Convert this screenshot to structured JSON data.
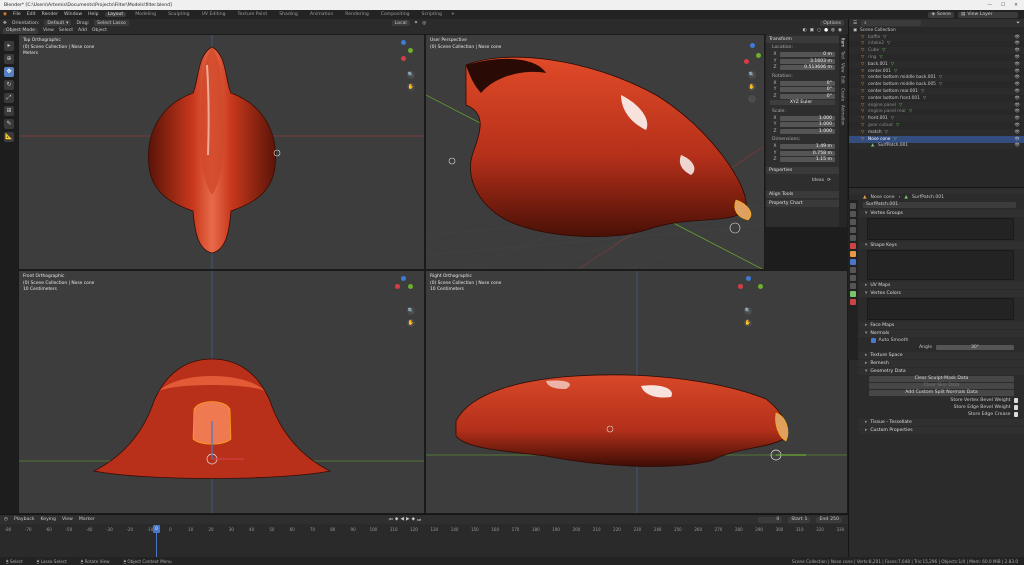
{
  "window": {
    "title": "Blender* [C:\\Users\\Artemis\\Documents\\Projects\\Filter\\Models\\filter.blend]"
  },
  "menus": [
    "File",
    "Edit",
    "Render",
    "Window",
    "Help"
  ],
  "workspaces": [
    "Layout",
    "Modeling",
    "Sculpting",
    "UV Editing",
    "Texture Paint",
    "Shading",
    "Animation",
    "Rendering",
    "Compositing",
    "Scripting"
  ],
  "active_workspace": "Layout",
  "header": {
    "scene_label": "Scene",
    "view_layer_label": "View Layer",
    "orientation_label": "Orientation:",
    "orientation_value": "Default",
    "drag_label": "Drag:",
    "drag_value": "Select Lasso",
    "pivot": "Local",
    "options": "Options"
  },
  "viewport_header": {
    "mode": "Object Mode",
    "view": "View",
    "select": "Select",
    "add": "Add",
    "object": "Object"
  },
  "viewports": [
    {
      "name": "Top Orthographic",
      "collection": "(0) Scene Collection | Nose cone",
      "units": "Meters"
    },
    {
      "name": "User Perspective",
      "collection": "(0) Scene Collection | Nose cone",
      "units": ""
    },
    {
      "name": "Front Orthographic",
      "collection": "(0) Scene Collection | Nose cone",
      "units": "10 Centimeters"
    },
    {
      "name": "Right Orthographic",
      "collection": "(0) Scene Collection | Nose cone",
      "units": "10 Centimeters"
    }
  ],
  "npanel": {
    "transform": "Transform",
    "location": "Location:",
    "loc": [
      {
        "k": "X",
        "v": "0 m"
      },
      {
        "k": "Y",
        "v": "3.1603 m"
      },
      {
        "k": "Z",
        "v": "0.513606 m"
      }
    ],
    "rotation": "Rotation:",
    "rot": [
      {
        "k": "X",
        "v": "0°"
      },
      {
        "k": "Y",
        "v": "0°"
      },
      {
        "k": "Z",
        "v": "0°"
      }
    ],
    "rot_mode": "XYZ Euler",
    "scale": "Scale:",
    "scl": [
      {
        "k": "X",
        "v": "1.000"
      },
      {
        "k": "Y",
        "v": "1.000"
      },
      {
        "k": "Z",
        "v": "1.000"
      }
    ],
    "dimensions": "Dimensions:",
    "dim": [
      {
        "k": "X",
        "v": "1.49 m"
      },
      {
        "k": "Y",
        "v": "0.758 m"
      },
      {
        "k": "Z",
        "v": "1.15 m"
      }
    ],
    "properties": "Properties",
    "ideas": "Ideas",
    "align_tools": "Align Tools",
    "property_chart": "Property Chart",
    "tabs": [
      "Item",
      "Tool",
      "View",
      "Edit",
      "Create",
      "Animation",
      "BlenderKit",
      "Archipack",
      "MACHIN3"
    ]
  },
  "outliner": {
    "root": "Scene Collection",
    "items": [
      {
        "name": "baffle",
        "extra": "",
        "dim": true
      },
      {
        "name": "intake2",
        "extra": "",
        "dim": true
      },
      {
        "name": "Cube",
        "extra": "",
        "dim": true
      },
      {
        "name": "ring",
        "extra": "",
        "dim": true
      },
      {
        "name": "back.001",
        "extra": "",
        "dim": false
      },
      {
        "name": "center.001",
        "extra": "",
        "dim": false
      },
      {
        "name": "center bottom middle back.001",
        "extra": "",
        "dim": false
      },
      {
        "name": "center bottom middle back.005",
        "extra": "",
        "dim": false
      },
      {
        "name": "center bottom rear.001",
        "extra": "",
        "dim": false
      },
      {
        "name": "center bottom front.001",
        "extra": "",
        "dim": false
      },
      {
        "name": "engine panel",
        "extra": "",
        "dim": true
      },
      {
        "name": "engine panel rear",
        "extra": "",
        "dim": true
      },
      {
        "name": "front.001",
        "extra": "",
        "dim": false
      },
      {
        "name": "gear cutout",
        "extra": "",
        "dim": true
      },
      {
        "name": "match",
        "extra": "",
        "dim": false
      },
      {
        "name": "Nose cone",
        "extra": "",
        "dim": false,
        "selected": true
      },
      {
        "name": "SurfPatch.001",
        "extra": "",
        "dim": false,
        "child": true
      }
    ]
  },
  "properties": {
    "object_name": "Nose cone",
    "data_name": "SurfPatch.001",
    "mesh_field": "SurfPatch.001",
    "sections": {
      "vertex_groups": "Vertex Groups",
      "shape_keys": "Shape Keys",
      "uv_maps": "UV Maps",
      "vertex_colors": "Vertex Colors",
      "face_maps": "Face Maps",
      "normals": "Normals",
      "auto_smooth": "Auto Smooth",
      "angle_label": "Angle",
      "angle_value": "30°",
      "texture_space": "Texture Space",
      "remesh": "Remesh",
      "geometry_data": "Geometry Data",
      "clear_sculpt": "Clear Sculpt-Mask Data",
      "clear_skin": "Clear Skin Data",
      "add_custom_split": "Add Custom Split Normals Data",
      "store_vertex_bevel": "Store Vertex Bevel Weight",
      "store_edge_bevel": "Store Edge Bevel Weight",
      "store_edge_crease": "Store Edge Crease",
      "tissue": "Tissue - Tessellate",
      "custom_props": "Custom Properties"
    }
  },
  "timeline": {
    "menus": [
      "Playback",
      "Keying",
      "View",
      "Marker"
    ],
    "current_frame": "0",
    "start_label": "Start",
    "start": "1",
    "end_label": "End",
    "end": "250",
    "ticks": [
      "-80",
      "-70",
      "-60",
      "-50",
      "-40",
      "-30",
      "-20",
      "-10",
      "0",
      "10",
      "20",
      "30",
      "40",
      "50",
      "60",
      "70",
      "80",
      "90",
      "100",
      "110",
      "120",
      "130",
      "140",
      "150",
      "160",
      "170",
      "180",
      "190",
      "200",
      "210",
      "220",
      "230",
      "240",
      "250",
      "260",
      "270",
      "280",
      "290",
      "300",
      "310",
      "320",
      "330"
    ]
  },
  "statusbar": {
    "select": "Select",
    "lasso": "Lasso Select",
    "rotate": "Rotate View",
    "context": "Object Context Menu",
    "stats": "Scene Collection | Nose cone | Verts:8,201 | Faces:7,648 | Tris:15,296 | Objects:1/4 | Mem: 60.0 MiB | 2.83.0"
  },
  "colors": {
    "accent": "#4a78c8",
    "mesh": "#c8381c",
    "outliner_sel": "#334d80",
    "axis_x": "#d63c45",
    "axis_y": "#6cae2e",
    "axis_z": "#3e7bd6"
  }
}
